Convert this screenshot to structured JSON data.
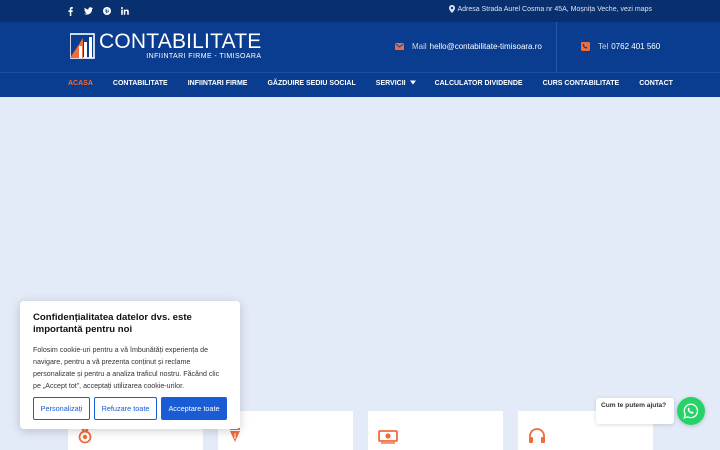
{
  "topbar": {
    "social": [
      "facebook-icon",
      "twitter-icon",
      "pinterest-icon",
      "linkedin-icon"
    ],
    "address": "Adresa Strada Aurel Cosma nr 45A, Moșnița Veche, vezi maps"
  },
  "header": {
    "logo_title": "CONTABILITATE",
    "logo_subtitle": "INFIINTARI FIRME - TIMISOARA",
    "mail_label": "Mail",
    "mail_value": "hello@contabilitate-timisoara.ro",
    "tel_label": "Tel",
    "tel_value": "0762 401 560"
  },
  "nav": {
    "items": [
      {
        "label": "ACASA",
        "active": true
      },
      {
        "label": "CONTABILITATE"
      },
      {
        "label": "INFIINTARI FIRME"
      },
      {
        "label": "GĂZDUIRE SEDIU SOCIAL"
      },
      {
        "label": "SERVICII",
        "dropdown": true
      },
      {
        "label": "CALCULATOR DIVIDENDE"
      },
      {
        "label": "CURS CONTABILITATE"
      },
      {
        "label": "CONTACT"
      }
    ]
  },
  "cookie": {
    "title": "Confidențialitatea datelor dvs. este importantă pentru noi",
    "text": "Folosim cookie-uri pentru a vă îmbunătăți experiența de navigare, pentru a vă prezenta conținut și reclame personalizate și pentru a analiza traficul nostru. Făcând clic pe „Accept tot”, acceptați utilizarea cookie-urilor.",
    "customize": "Personalizați",
    "reject": "Refuzare toate",
    "accept": "Acceptare toate"
  },
  "whatsapp": {
    "bubble": "Cum te putem ajuta?"
  },
  "colors": {
    "topbar": "#082f6e",
    "header": "#0a3d8f",
    "accent": "#f26b3a",
    "primary_button": "#1a5bd6",
    "whatsapp": "#25d366",
    "page_bg": "#e3eaf8"
  },
  "cards": [
    "medal-icon",
    "pen-nib-icon",
    "money-icon",
    "headset-icon"
  ]
}
